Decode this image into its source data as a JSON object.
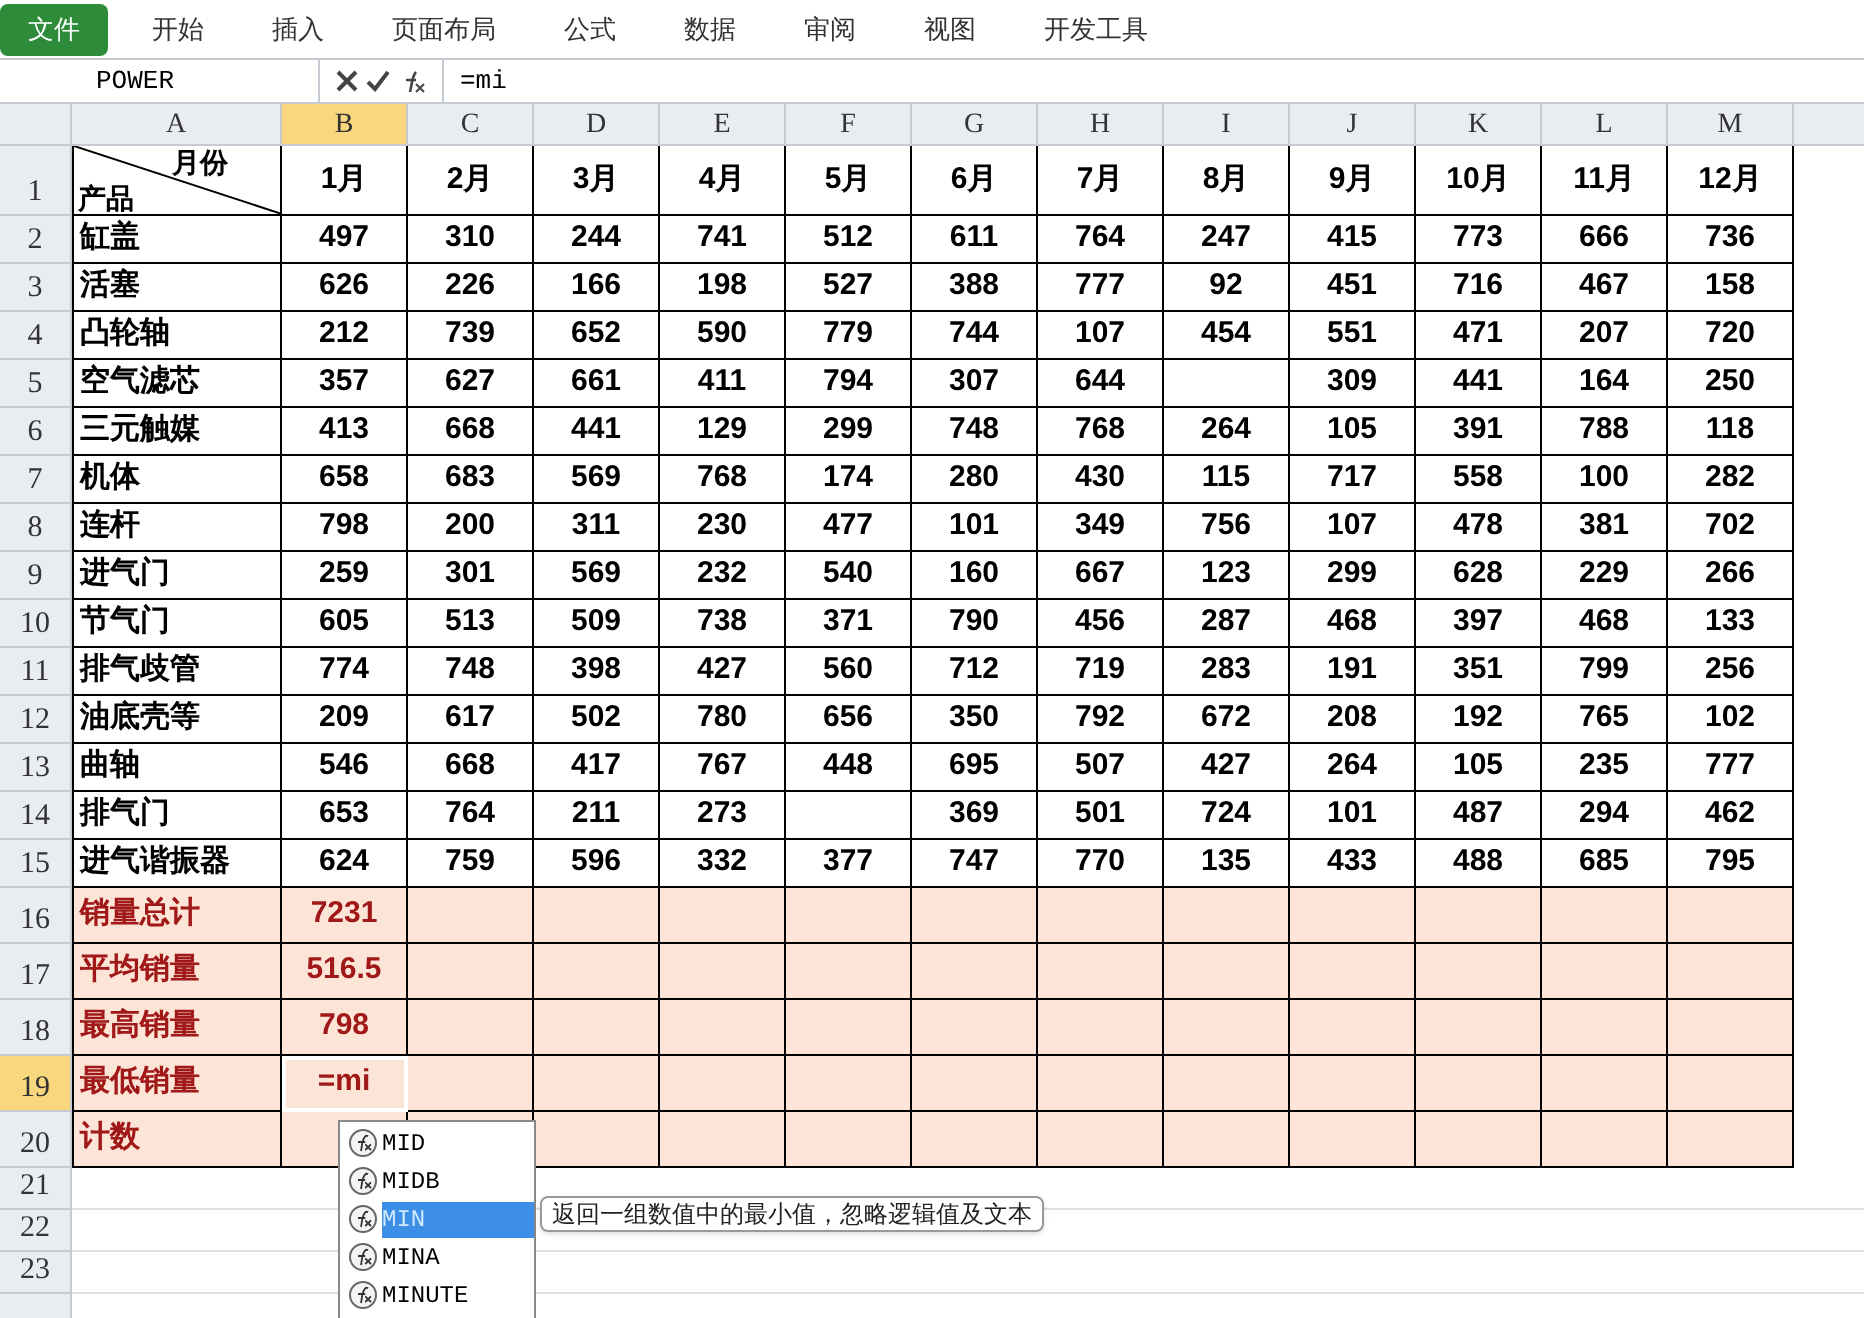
{
  "ribbon_tabs": [
    {
      "label": "文件",
      "selected": true
    },
    {
      "label": "开始",
      "selected": false
    },
    {
      "label": "插入",
      "selected": false
    },
    {
      "label": "页面布局",
      "selected": false
    },
    {
      "label": "公式",
      "selected": false
    },
    {
      "label": "数据",
      "selected": false
    },
    {
      "label": "审阅",
      "selected": false
    },
    {
      "label": "视图",
      "selected": false
    },
    {
      "label": "开发工具",
      "selected": false
    }
  ],
  "name_box": "POWER",
  "formula": "=mi",
  "columns": [
    {
      "label": "A",
      "selected": false
    },
    {
      "label": "B",
      "selected": true
    },
    {
      "label": "C",
      "selected": false
    },
    {
      "label": "D",
      "selected": false
    },
    {
      "label": "E",
      "selected": false
    },
    {
      "label": "F",
      "selected": false
    },
    {
      "label": "G",
      "selected": false
    },
    {
      "label": "H",
      "selected": false
    },
    {
      "label": "I",
      "selected": false
    },
    {
      "label": "J",
      "selected": false
    },
    {
      "label": "K",
      "selected": false
    },
    {
      "label": "L",
      "selected": false
    },
    {
      "label": "M",
      "selected": false
    }
  ],
  "header_row": {
    "number": "1",
    "corner_top": "月份",
    "corner_bottom": "产品",
    "months": [
      "1月",
      "2月",
      "3月",
      "4月",
      "5月",
      "6月",
      "7月",
      "8月",
      "9月",
      "10月",
      "11月",
      "12月"
    ]
  },
  "rows": [
    {
      "number": "2",
      "product": "缸盖",
      "values": [
        "497",
        "310",
        "244",
        "741",
        "512",
        "611",
        "764",
        "247",
        "415",
        "773",
        "666",
        "736"
      ]
    },
    {
      "number": "3",
      "product": "活塞",
      "values": [
        "626",
        "226",
        "166",
        "198",
        "527",
        "388",
        "777",
        "92",
        "451",
        "716",
        "467",
        "158"
      ]
    },
    {
      "number": "4",
      "product": "凸轮轴",
      "values": [
        "212",
        "739",
        "652",
        "590",
        "779",
        "744",
        "107",
        "454",
        "551",
        "471",
        "207",
        "720"
      ]
    },
    {
      "number": "5",
      "product": "空气滤芯",
      "values": [
        "357",
        "627",
        "661",
        "411",
        "794",
        "307",
        "644",
        {
          "kind": "blank"
        },
        "309",
        "441",
        "164",
        "250"
      ]
    },
    {
      "number": "6",
      "product": "三元触媒",
      "values": [
        "413",
        "668",
        "441",
        "129",
        "299",
        "748",
        "768",
        "264",
        "105",
        "391",
        "788",
        "118"
      ]
    },
    {
      "number": "7",
      "product": "机体",
      "values": [
        "658",
        "683",
        "569",
        "768",
        "174",
        "280",
        "430",
        "115",
        "717",
        "558",
        "100",
        "282"
      ]
    },
    {
      "number": "8",
      "product": "连杆",
      "values": [
        "798",
        "200",
        "311",
        "230",
        "477",
        "101",
        "349",
        "756",
        "107",
        "478",
        "381",
        "702"
      ]
    },
    {
      "number": "9",
      "product": "进气门",
      "values": [
        "259",
        "301",
        "569",
        "232",
        "540",
        "160",
        "667",
        "123",
        "299",
        "628",
        "229",
        "266"
      ]
    },
    {
      "number": "10",
      "product": "节气门",
      "values": [
        "605",
        "513",
        "509",
        "738",
        "371",
        "790",
        "456",
        "287",
        "468",
        "397",
        "468",
        "133"
      ]
    },
    {
      "number": "11",
      "product": "排气歧管",
      "values": [
        "774",
        "748",
        "398",
        "427",
        "560",
        "712",
        "719",
        "283",
        "191",
        "351",
        "799",
        "256"
      ]
    },
    {
      "number": "12",
      "product": "油底壳等",
      "values": [
        "209",
        "617",
        "502",
        "780",
        "656",
        "350",
        "792",
        "672",
        "208",
        "192",
        "765",
        "102"
      ]
    },
    {
      "number": "13",
      "product": "曲轴",
      "values": [
        "546",
        "668",
        "417",
        "767",
        "448",
        "695",
        "507",
        "427",
        "264",
        "105",
        "235",
        "777"
      ]
    },
    {
      "number": "14",
      "product": "排气门",
      "values": [
        "653",
        "764",
        "211",
        "273",
        {
          "kind": "blank"
        },
        "369",
        "501",
        "724",
        "101",
        "487",
        "294",
        "462"
      ]
    },
    {
      "number": "15",
      "product": "进气谐振器",
      "values": [
        "624",
        "759",
        "596",
        "332",
        "377",
        "747",
        "770",
        "135",
        "433",
        "488",
        "685",
        "795"
      ]
    }
  ],
  "summary_rows": [
    {
      "number": "16",
      "label": "销量总计",
      "value": "7231",
      "selected": false
    },
    {
      "number": "17",
      "label": "平均销量",
      "value": "516.5",
      "selected": false
    },
    {
      "number": "18",
      "label": "最高销量",
      "value": "798",
      "selected": false
    },
    {
      "number": "19",
      "label": "最低销量",
      "value": "=mi",
      "selected": true
    },
    {
      "number": "20",
      "label": "计数",
      "selected": false
    }
  ],
  "empty_rows": [
    "21",
    "22",
    "23"
  ],
  "autocomplete": {
    "items": [
      {
        "label": "MID",
        "selected": false
      },
      {
        "label": "MIDB",
        "selected": false
      },
      {
        "label": "MIN",
        "selected": true
      },
      {
        "label": "MINA",
        "selected": false
      },
      {
        "label": "MINUTE",
        "selected": false
      }
    ],
    "tooltip": "返回一组数值中的最小值，忽略逻辑值及文本"
  }
}
